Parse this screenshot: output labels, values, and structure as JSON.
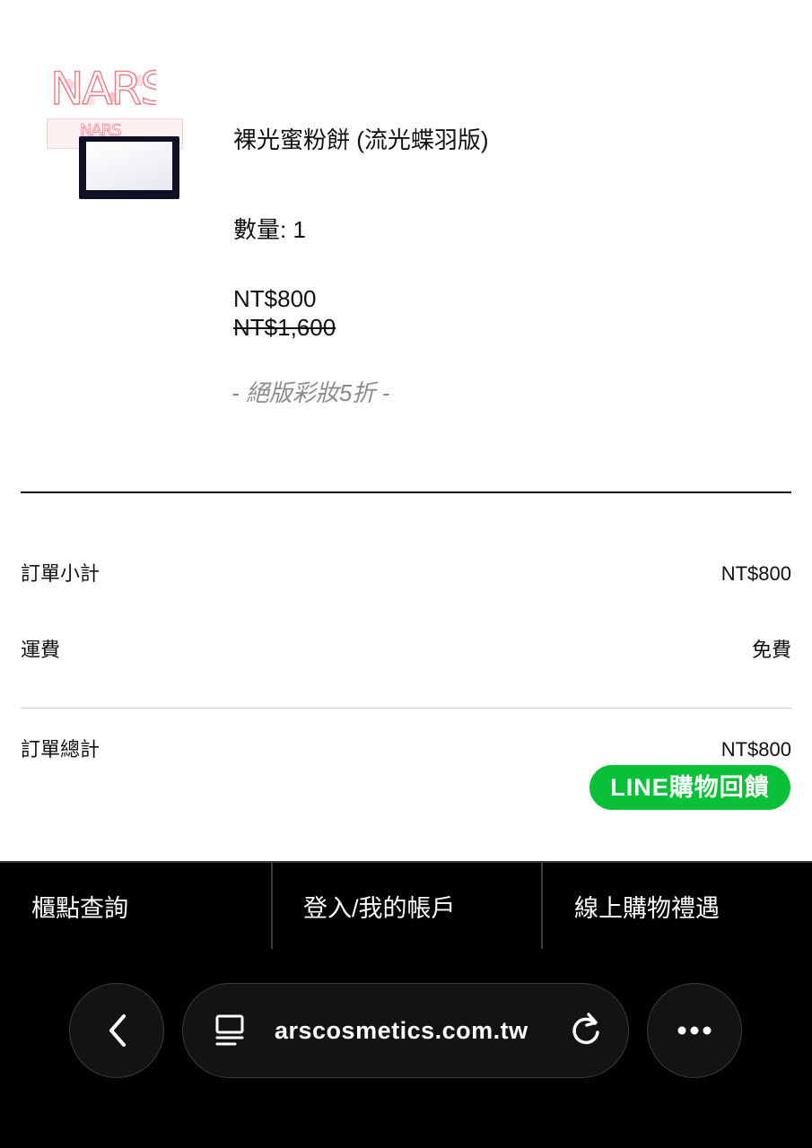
{
  "product": {
    "brand_logo": "NARS",
    "name": "裸光蜜粉餅 (流光蝶羽版)",
    "quantity": "數量: 1",
    "price_current": "NT$800",
    "price_original": "NT$1,600",
    "promo": "- 絕版彩妝5折 -"
  },
  "summary": {
    "subtotal_label": "訂單小計",
    "subtotal_value": "NT$800",
    "shipping_label": "運費",
    "shipping_value": "免費",
    "total_label": "訂單總計",
    "total_value": "NT$800",
    "line_badge": "LINE購物回饋"
  },
  "footer": {
    "links": [
      "櫃點查詢",
      "登入/我的帳戶",
      "線上購物禮遇"
    ]
  },
  "browser": {
    "url": "arscosmetics.com.tw",
    "back_icon": "chevron-left-icon",
    "tabs_icon": "tabs-icon",
    "reload_icon": "reload-icon",
    "more_icon": "more-icon"
  },
  "colors": {
    "line_green": "#09c139",
    "logo_pink": "#ef7c86",
    "footer_bg": "#000000"
  }
}
